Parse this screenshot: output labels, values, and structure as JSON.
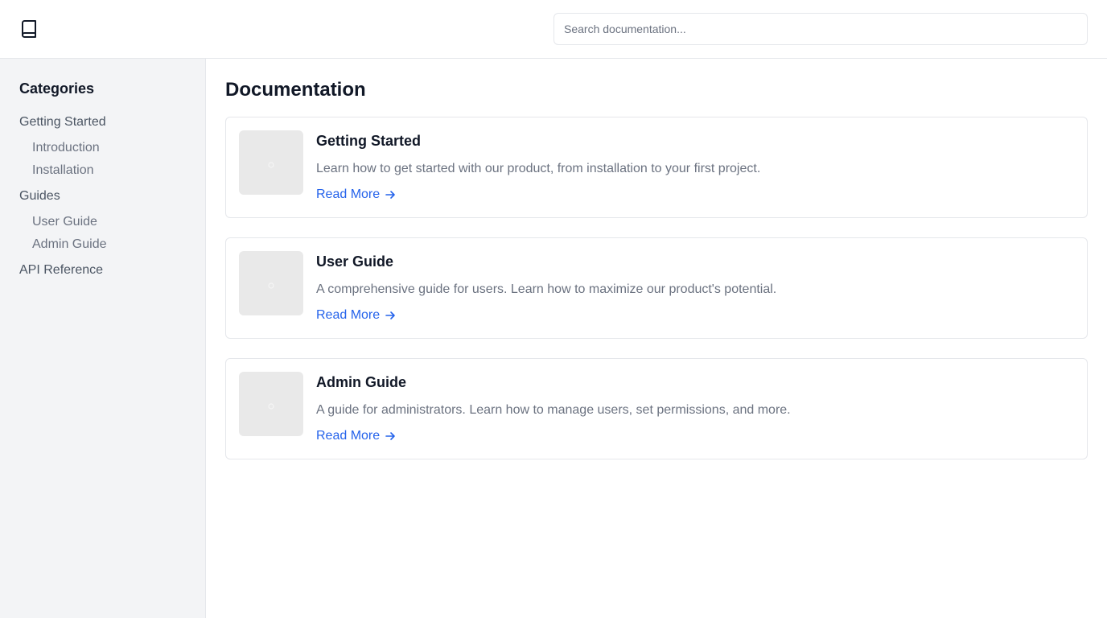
{
  "header": {
    "logo_icon": "book-icon",
    "search_placeholder": "Search documentation..."
  },
  "sidebar": {
    "heading": "Categories",
    "groups": [
      {
        "label": "Getting Started",
        "children": [
          "Introduction",
          "Installation"
        ]
      },
      {
        "label": "Guides",
        "children": [
          "User Guide",
          "Admin Guide"
        ]
      },
      {
        "label": "API Reference",
        "children": []
      }
    ]
  },
  "main": {
    "title": "Documentation",
    "cards": [
      {
        "title": "Getting Started",
        "description": "Learn how to get started with our product, from installation to your first project.",
        "link": "Read More"
      },
      {
        "title": "User Guide",
        "description": "A comprehensive guide for users. Learn how to maximize our product's potential.",
        "link": "Read More"
      },
      {
        "title": "Admin Guide",
        "description": "A guide for administrators. Learn how to manage users, set permissions, and more.",
        "link": "Read More"
      }
    ]
  },
  "colors": {
    "link": "#2563eb",
    "sidebar_bg": "#f3f4f6",
    "border": "#e5e7eb"
  }
}
